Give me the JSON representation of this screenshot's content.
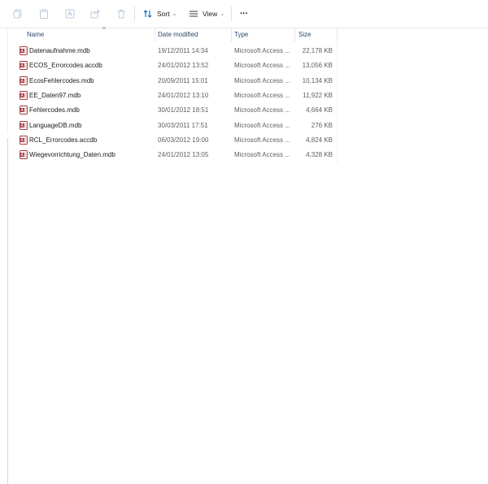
{
  "toolbar": {
    "sort_label": "Sort",
    "view_label": "View",
    "more_label": "···",
    "chevron": "⌄"
  },
  "columns": {
    "name": "Name",
    "date": "Date modified",
    "type": "Type",
    "size": "Size",
    "sort_indicator": "^"
  },
  "files": [
    {
      "name": "Datenaufnahme.mdb",
      "date": "19/12/2011 14:34",
      "type": "Microsoft Access ...",
      "size": "22,178 KB"
    },
    {
      "name": "ECOS_Errorcodes.accdb",
      "date": "24/01/2012 13:52",
      "type": "Microsoft Access ...",
      "size": "13,056 KB"
    },
    {
      "name": "EcosFehlercodes.mdb",
      "date": "20/09/2011 15:01",
      "type": "Microsoft Access ...",
      "size": "10,134 KB"
    },
    {
      "name": "EE_Daten97.mdb",
      "date": "24/01/2012 13:10",
      "type": "Microsoft Access ...",
      "size": "11,922 KB"
    },
    {
      "name": "Fehlercodes.mdb",
      "date": "30/01/2012 18:51",
      "type": "Microsoft Access ...",
      "size": "4,664 KB"
    },
    {
      "name": "LanguageDB.mdb",
      "date": "30/03/2011 17:51",
      "type": "Microsoft Access ...",
      "size": "276 KB"
    },
    {
      "name": "RCL_Errorcodes.accdb",
      "date": "06/03/2012 19:00",
      "type": "Microsoft Access ...",
      "size": "4,824 KB"
    },
    {
      "name": "Wiegevorrichtung_Daten.mdb",
      "date": "24/01/2012 13:05",
      "type": "Microsoft Access ...",
      "size": "4,328 KB"
    }
  ],
  "colors": {
    "accent": "#0067c0",
    "access_red": "#a4373a",
    "icon_disabled": "#b8c9dc"
  }
}
